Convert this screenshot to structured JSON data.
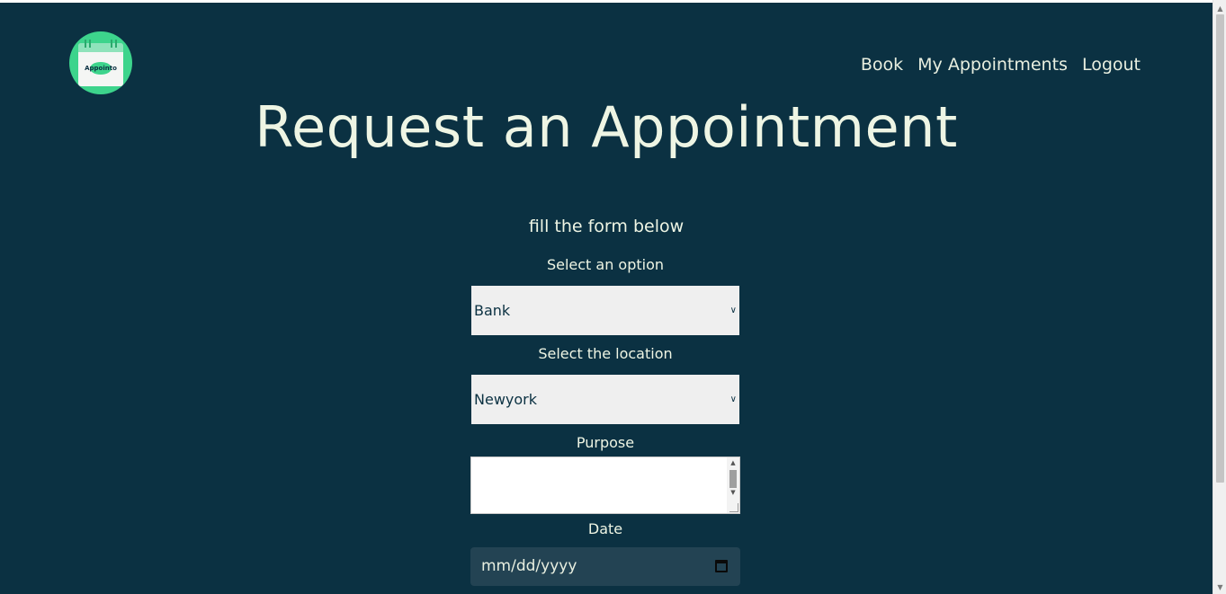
{
  "brand": {
    "logo_text": "Appointo"
  },
  "nav": {
    "items": [
      "Book",
      "My Appointments",
      "Logout"
    ]
  },
  "page": {
    "title": "Request an Appointment",
    "subtitle": "fill the form below"
  },
  "form": {
    "option_label": "Select an option",
    "option_value": "Bank",
    "location_label": "Select the location",
    "location_value": "Newyork",
    "purpose_label": "Purpose",
    "date_label": "Date",
    "date_placeholder": "mm/dd/yyyy"
  },
  "colors": {
    "background": "#0b3142",
    "accent": "#3dd48c",
    "text": "#eef5e4"
  }
}
